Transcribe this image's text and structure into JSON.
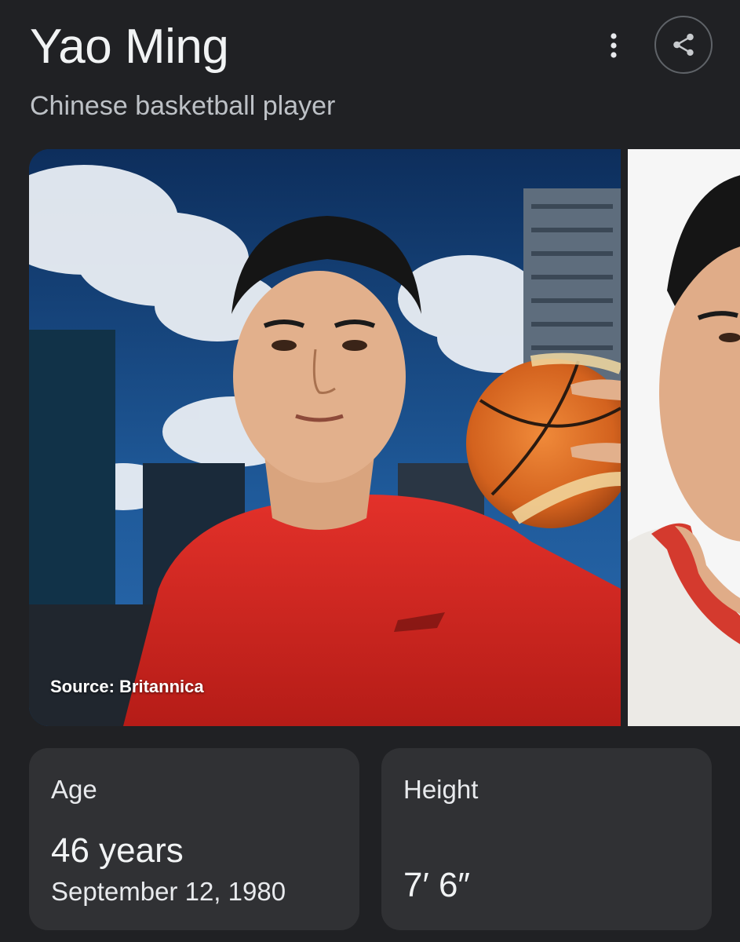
{
  "header": {
    "title": "Yao Ming",
    "subtitle": "Chinese basketball player",
    "more_icon": "more-vert-icon",
    "share_icon": "share-icon"
  },
  "images": {
    "main_caption": "Source: Britannica"
  },
  "facts": {
    "age": {
      "label": "Age",
      "value": "46 years",
      "detail": "September 12, 1980"
    },
    "height": {
      "label": "Height",
      "value": "7′ 6″"
    }
  },
  "colors": {
    "background": "#202124",
    "card": "#303134",
    "text_primary": "#e8eaed",
    "text_secondary": "#bdc1c6",
    "jersey_red": "#d4251f"
  }
}
